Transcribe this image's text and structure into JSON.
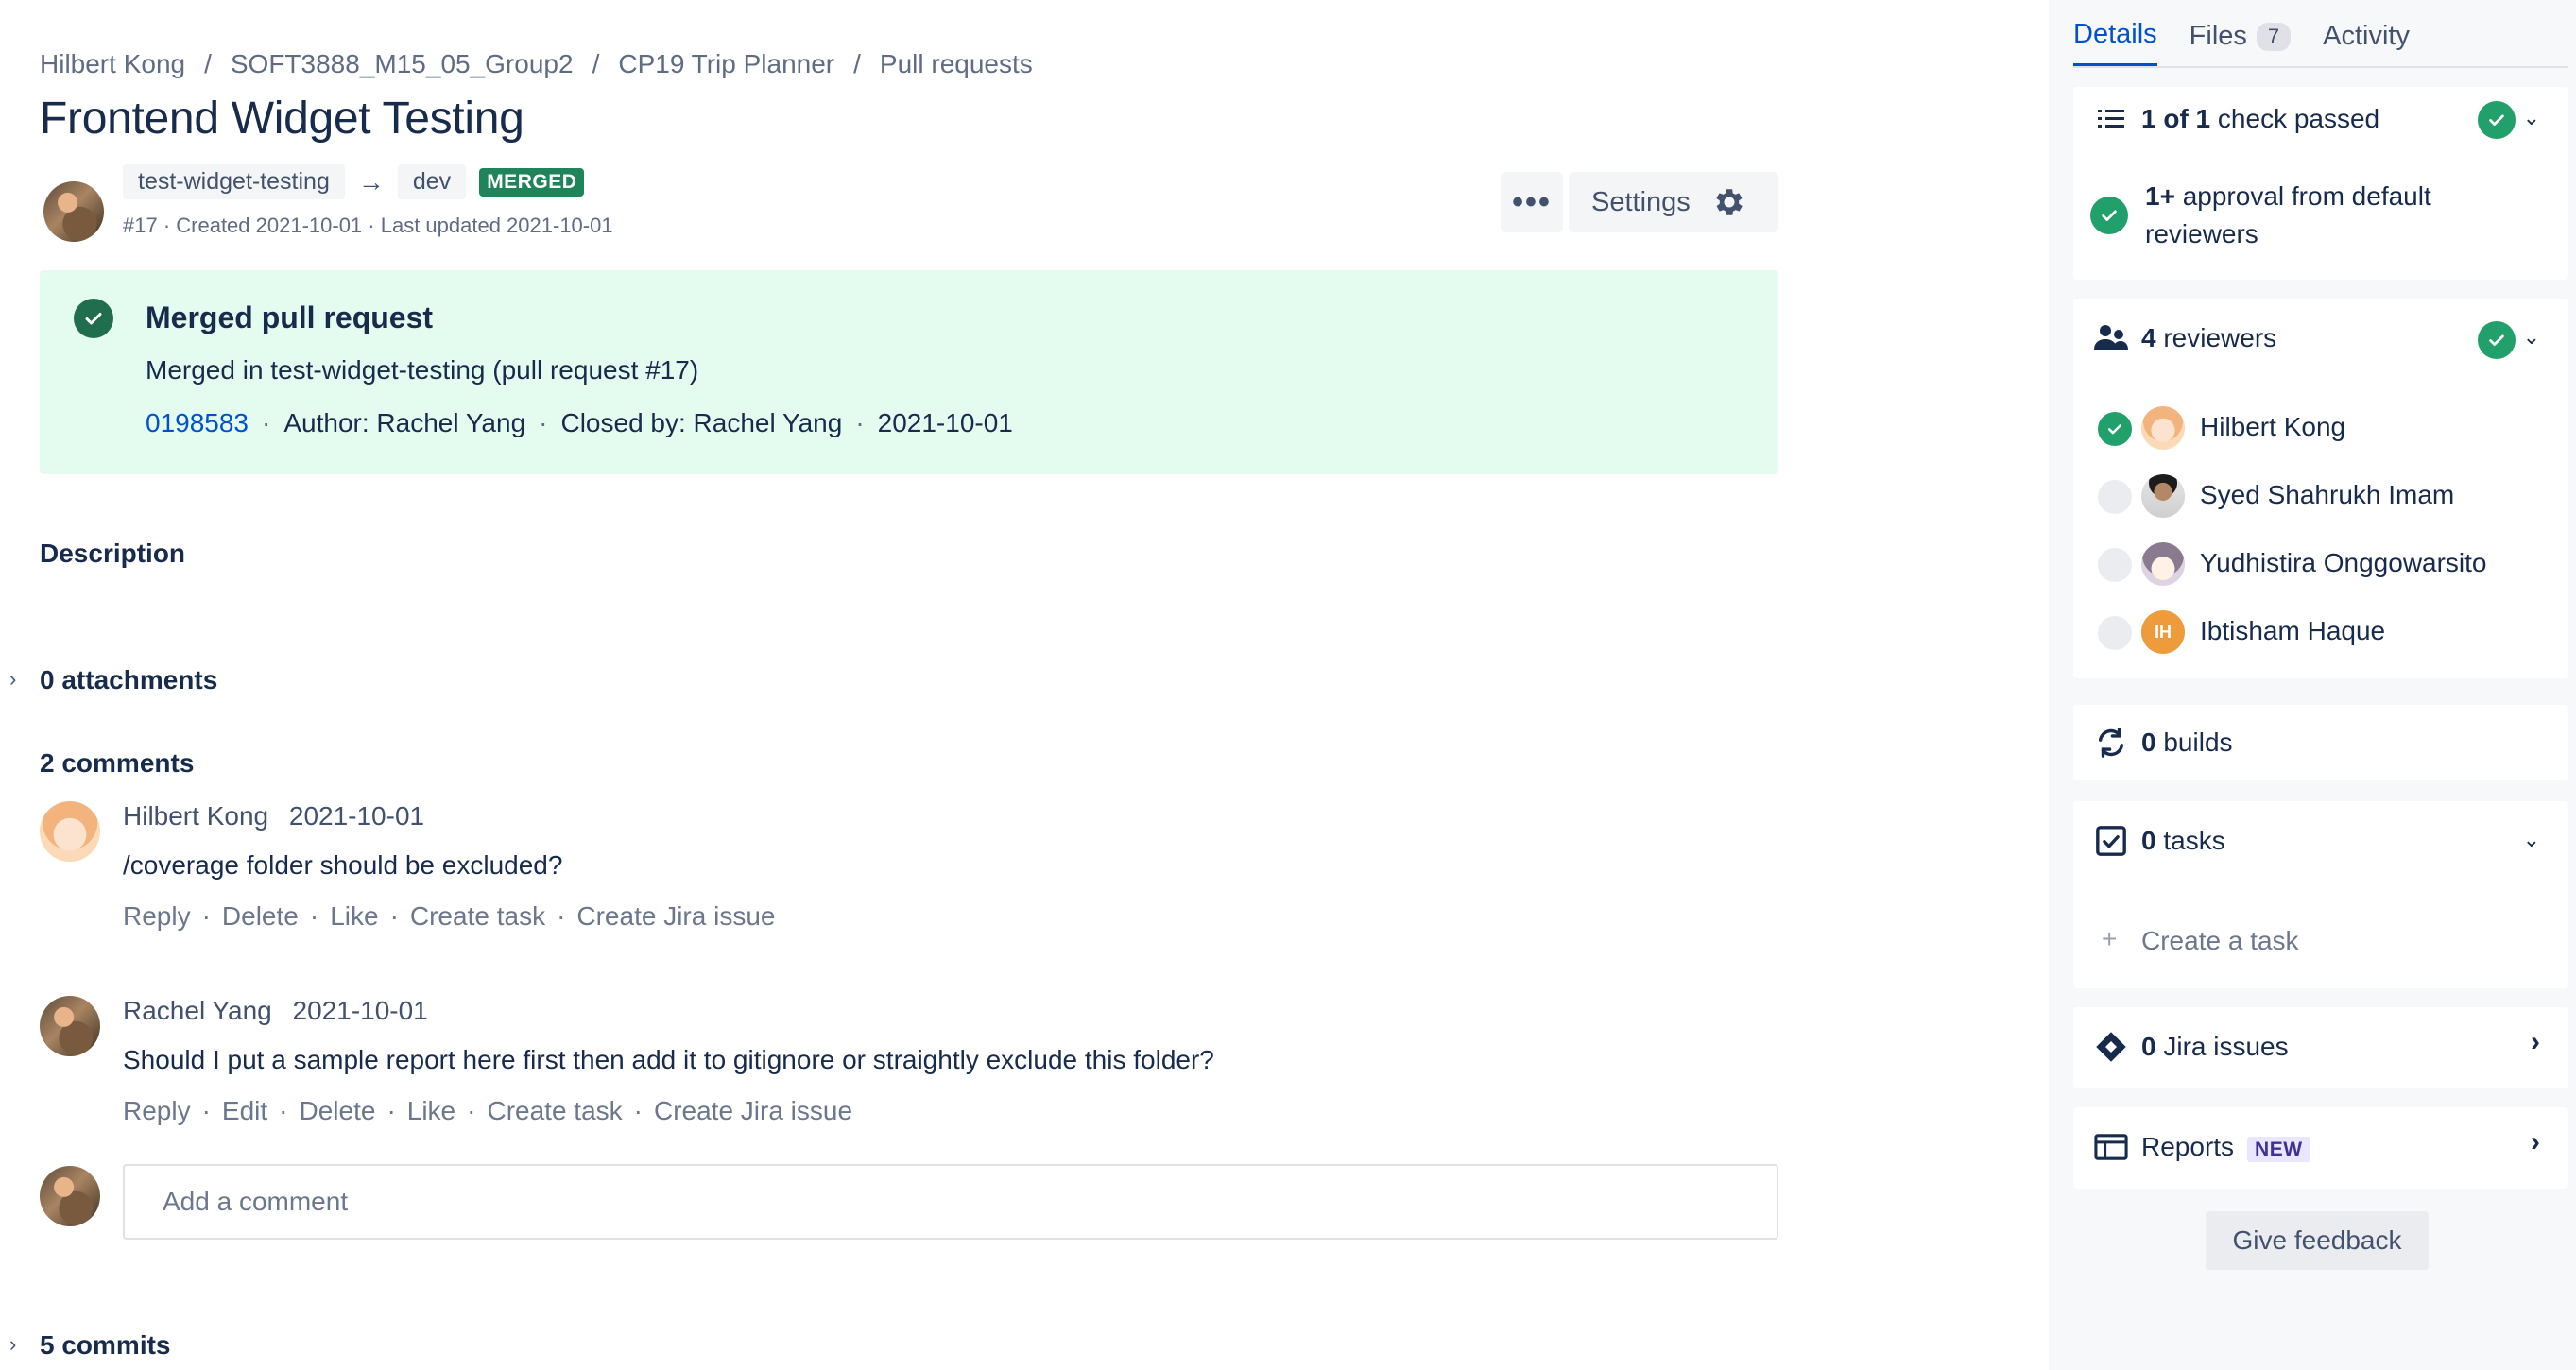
{
  "breadcrumb": [
    "Hilbert Kong",
    "SOFT3888_M15_05_Group2",
    "CP19 Trip Planner",
    "Pull requests"
  ],
  "page_title": "Frontend Widget Testing",
  "pr": {
    "source_branch": "test-widget-testing",
    "target_branch": "dev",
    "state_badge": "MERGED",
    "meta": "#17 · Created 2021-10-01 · Last updated 2021-10-01"
  },
  "toolbar": {
    "more_label": "•••",
    "settings_label": "Settings"
  },
  "merged_banner": {
    "title": "Merged pull request",
    "line": "Merged in test-widget-testing (pull request #17)",
    "commit_hash": "0198583",
    "author": "Author: Rachel Yang",
    "closed_by": "Closed by: Rachel Yang",
    "date": "2021-10-01",
    "sep": "·"
  },
  "description_heading": "Description",
  "attachments_label": "0 attachments",
  "comments_heading": "2 comments",
  "comments": [
    {
      "author": "Hilbert Kong",
      "date": "2021-10-01",
      "body": "/coverage folder should be excluded?",
      "actions": [
        "Reply",
        "Delete",
        "Like",
        "Create task",
        "Create Jira issue"
      ]
    },
    {
      "author": "Rachel Yang",
      "date": "2021-10-01",
      "body": "Should I put a sample report here first then add it to gitignore or straightly exclude this folder?",
      "actions": [
        "Reply",
        "Edit",
        "Delete",
        "Like",
        "Create task",
        "Create Jira issue"
      ]
    }
  ],
  "add_comment_placeholder": "Add a comment",
  "commits_label": "5 commits",
  "sidebar": {
    "tabs": {
      "details": "Details",
      "files": "Files",
      "files_count": "7",
      "activity": "Activity"
    },
    "checks": {
      "count_strong": "1 of 1",
      "count_rest": " check passed",
      "approval_strong": "1+",
      "approval_rest": " approval from default reviewers"
    },
    "reviewers": {
      "count_strong": "4",
      "count_rest": " reviewers",
      "list": [
        {
          "name": "Hilbert Kong",
          "approved": true
        },
        {
          "name": "Syed Shahrukh Imam",
          "approved": false
        },
        {
          "name": "Yudhistira Onggowarsito",
          "approved": false
        },
        {
          "name": "Ibtisham Haque",
          "approved": false,
          "initials": "IH"
        }
      ]
    },
    "builds": {
      "count_strong": "0",
      "count_rest": " builds"
    },
    "tasks": {
      "count_strong": "0",
      "count_rest": " tasks",
      "create_label": "Create a task",
      "plus": "+"
    },
    "jira": {
      "count_strong": "0",
      "count_rest": " Jira issues"
    },
    "reports": {
      "label": "Reports",
      "badge": "NEW"
    },
    "feedback_label": "Give feedback"
  },
  "colors": {
    "accent": "#0052cc",
    "success": "#22a06b",
    "merged_banner_bg": "#e3fcef",
    "merged_lozenge": "#1f845a",
    "new_lozenge_bg": "#eae6ff"
  }
}
